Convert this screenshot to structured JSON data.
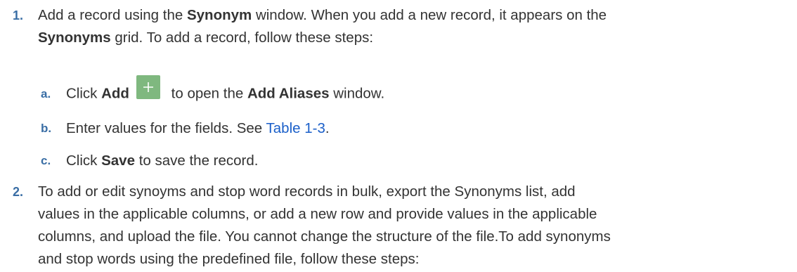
{
  "steps": [
    {
      "number": "1.",
      "parts": {
        "t1": "Add a record using the ",
        "b1": "Synonym",
        "t2": " window. When you add a new record, it appears on the",
        "b2": "Synonyms",
        "t3": " grid. To add a record, follow these steps:"
      },
      "substeps": [
        {
          "letter": "a.",
          "t1": "Click ",
          "b1": "Add",
          "icon": "plus-icon",
          "t2": " to open the ",
          "b2": "Add Aliases",
          "t3": " window."
        },
        {
          "letter": "b.",
          "t1": "Enter values for the fields. See ",
          "link": "Table 1-3",
          "t2": "."
        },
        {
          "letter": "c.",
          "t1": "Click ",
          "b1": "Save",
          "t2": " to save the record."
        }
      ]
    },
    {
      "number": "2.",
      "lines": [
        "To add or edit synoyms and stop word records in bulk, export the Synonyms list, add",
        "values in the applicable columns, or add a new row and provide values in the applicable",
        "columns, and upload the file. You cannot change the structure of the file.To add synonyms",
        "and stop words using the predefined file, follow these steps:"
      ]
    }
  ],
  "colors": {
    "number": "#3a6ea5",
    "link": "#1a5fc9",
    "add_button": "#7fb87f"
  }
}
